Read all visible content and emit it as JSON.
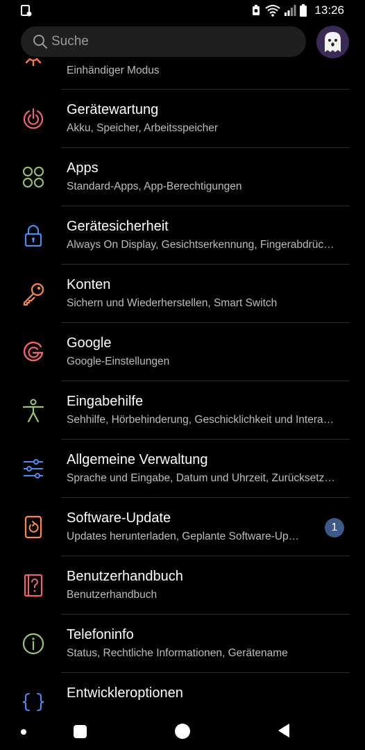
{
  "status_bar": {
    "time": "13:26",
    "icons": [
      "notification-icon",
      "battery-saver-icon",
      "wifi-icon",
      "signal-icon",
      "battery-icon"
    ]
  },
  "search": {
    "placeholder": "Suche"
  },
  "settings_items": [
    {
      "title": "",
      "subtitle": "Einhändiger Modus",
      "icon": "gear-icon",
      "color": "#ff7a45"
    },
    {
      "title": "Gerätewartung",
      "subtitle": "Akku, Speicher, Arbeitsspeicher",
      "icon": "device-care-icon",
      "color": "#f0646e"
    },
    {
      "title": "Apps",
      "subtitle": "Standard-Apps, App-Berechtigungen",
      "icon": "apps-grid-icon",
      "color": "#9bc86e"
    },
    {
      "title": "Gerätesicherheit",
      "subtitle": "Always On Display, Gesichtserkennung, Fingerabdrüc…",
      "icon": "lock-icon",
      "color": "#4c8cf5"
    },
    {
      "title": "Konten",
      "subtitle": "Sichern und Wiederherstellen, Smart Switch",
      "icon": "key-icon",
      "color": "#ff8a45"
    },
    {
      "title": "Google",
      "subtitle": "Google-Einstellungen",
      "icon": "google-icon",
      "color": "#f0646e"
    },
    {
      "title": "Eingabehilfe",
      "subtitle": "Sehhilfe, Hörbehinderung, Geschicklichkeit und Intera…",
      "icon": "accessibility-icon",
      "color": "#9bc86e"
    },
    {
      "title": "Allgemeine Verwaltung",
      "subtitle": "Sprache und Eingabe, Datum und Uhrzeit, Zurücksetz…",
      "icon": "sliders-icon",
      "color": "#4c8cf5"
    },
    {
      "title": "Software-Update",
      "subtitle": "Updates herunterladen, Geplante Software-Up…",
      "icon": "software-update-icon",
      "color": "#ff8a45",
      "badge": "1"
    },
    {
      "title": "Benutzerhandbuch",
      "subtitle": "Benutzerhandbuch",
      "icon": "user-manual-icon",
      "color": "#f0646e"
    },
    {
      "title": "Telefoninfo",
      "subtitle": "Status, Rechtliche Informationen, Gerätename",
      "icon": "info-icon",
      "color": "#9bc86e"
    },
    {
      "title": "Entwickleroptionen",
      "subtitle": "",
      "icon": "developer-options-icon",
      "color": "#4c8cf5"
    }
  ],
  "colors": {
    "background": "#000000",
    "badge": "#3d5a86"
  },
  "nav_bar": {
    "icons": [
      "nav-dot-icon",
      "recent-apps-icon",
      "home-icon",
      "back-icon"
    ]
  }
}
